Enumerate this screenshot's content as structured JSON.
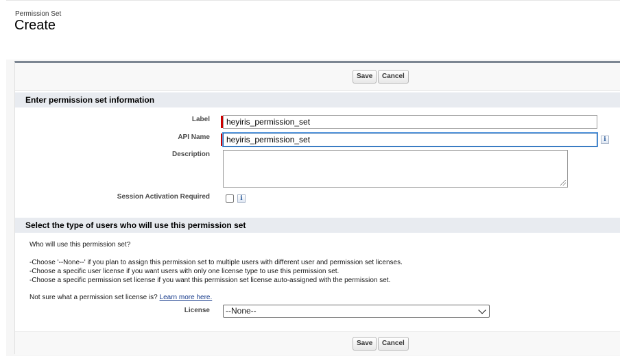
{
  "header": {
    "eyebrow": "Permission Set",
    "title": "Create"
  },
  "buttons": {
    "save": "Save",
    "cancel": "Cancel"
  },
  "info_section": {
    "heading": "Enter permission set information",
    "label_field": {
      "label": "Label",
      "value": "heyiris_permission_set"
    },
    "api_name_field": {
      "label": "API Name",
      "value": "heyiris_permission_set"
    },
    "description_field": {
      "label": "Description",
      "value": ""
    },
    "session_field": {
      "label": "Session Activation Required",
      "checked": false
    }
  },
  "users_section": {
    "heading": "Select the type of users who will use this permission set",
    "question": "Who will use this permission set?",
    "bullets": [
      "-Choose '--None--' if you plan to assign this permission set to multiple users with different user and permission set licenses.",
      "-Choose a specific user license if you want users with only one license type to use this permission set.",
      "-Choose a specific permission set license if you want this permission set license auto-assigned with the permission set."
    ],
    "not_sure_text": "Not sure what a permission set license is?",
    "learn_more_link": "Learn more here.",
    "license_label": "License",
    "license_selected": "--None--"
  },
  "icons": {
    "info": "info-icon",
    "dropdown": "chevron-down-icon"
  },
  "colors": {
    "required": "#cc0000",
    "section_bg": "#e8ebf0",
    "focus": "#1b5fa8",
    "link": "#15398a"
  }
}
